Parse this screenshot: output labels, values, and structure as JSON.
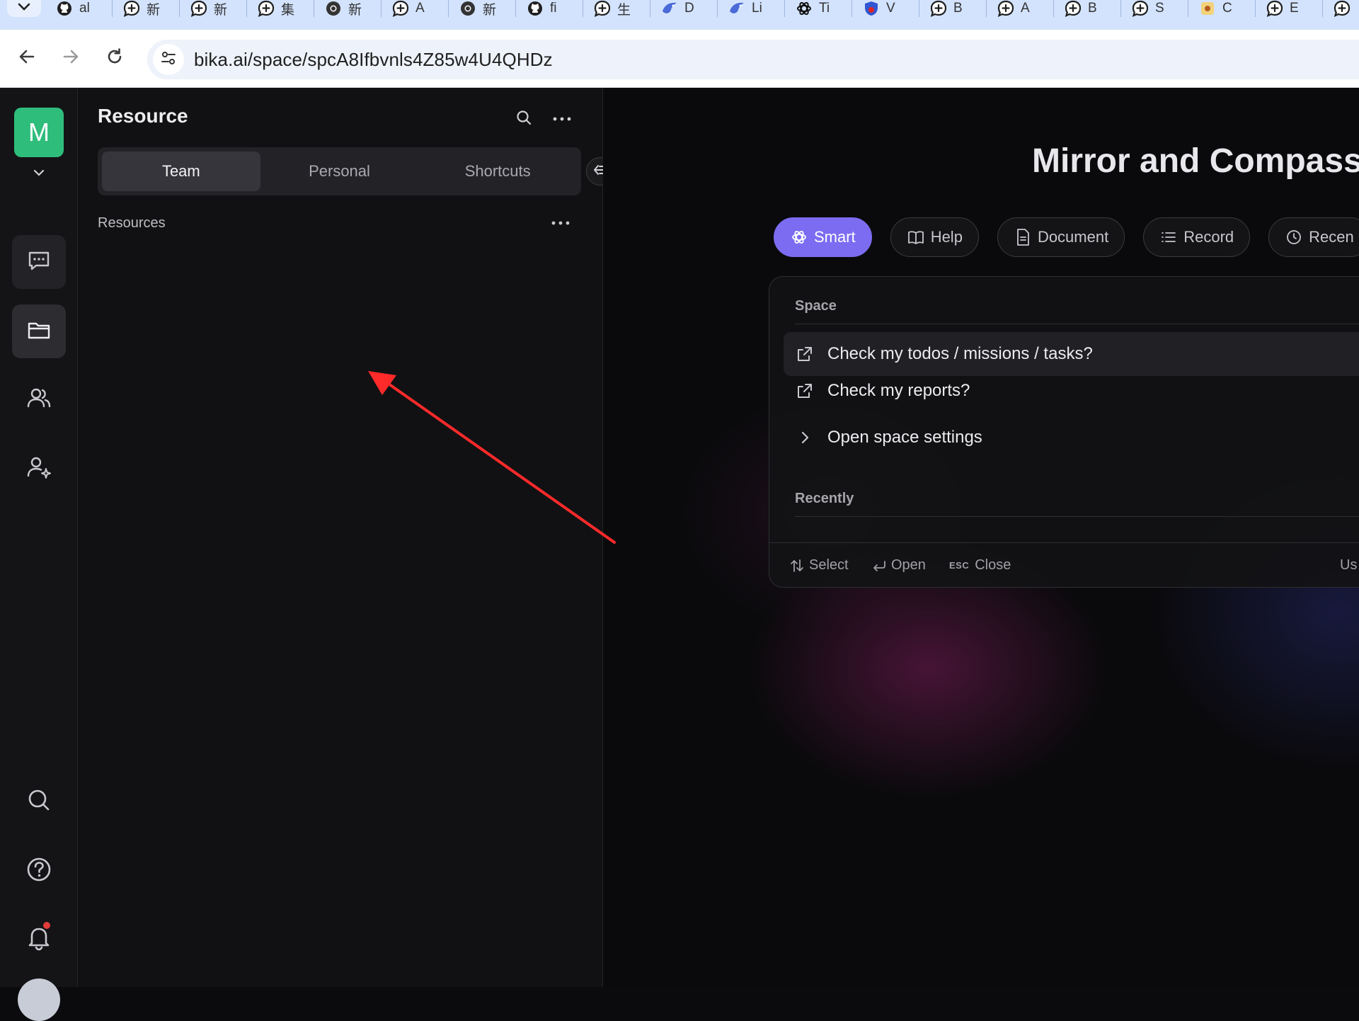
{
  "browser": {
    "tabs": [
      {
        "icon": "github-icon",
        "label": "al"
      },
      {
        "icon": "chat-plus-icon",
        "label": "新"
      },
      {
        "icon": "chat-plus-icon",
        "label": "新"
      },
      {
        "icon": "chat-plus-icon",
        "label": "集"
      },
      {
        "icon": "chrome-icon",
        "label": "新"
      },
      {
        "icon": "chat-plus-icon",
        "label": "A"
      },
      {
        "icon": "chrome-icon",
        "label": "新"
      },
      {
        "icon": "github-icon",
        "label": "fi"
      },
      {
        "icon": "chat-plus-icon",
        "label": "生"
      },
      {
        "icon": "bird-icon",
        "label": "D"
      },
      {
        "icon": "bird-icon",
        "label": "Li"
      },
      {
        "icon": "openai-icon",
        "label": "Ti"
      },
      {
        "icon": "shield-icon",
        "label": "V"
      },
      {
        "icon": "chat-plus-icon",
        "label": "B"
      },
      {
        "icon": "chat-plus-icon",
        "label": "A"
      },
      {
        "icon": "chat-plus-icon",
        "label": "B"
      },
      {
        "icon": "chat-plus-icon",
        "label": "S"
      },
      {
        "icon": "app-icon",
        "label": "C"
      },
      {
        "icon": "chat-plus-icon",
        "label": "E"
      },
      {
        "icon": "chat-plus-icon",
        "label": ""
      }
    ],
    "url": "bika.ai/space/spcA8Ifbvnls4Z85w4U4QHDz"
  },
  "rail": {
    "avatar_letter": "M"
  },
  "panel": {
    "title": "Resource",
    "tabs": [
      "Team",
      "Personal",
      "Shortcuts"
    ],
    "section_label": "Resources"
  },
  "main": {
    "title": "Mirror and Compass",
    "chips": [
      {
        "label": "Smart",
        "icon": "openai-icon",
        "active": true
      },
      {
        "label": "Help",
        "icon": "book-icon",
        "active": false
      },
      {
        "label": "Document",
        "icon": "document-icon",
        "active": false
      },
      {
        "label": "Record",
        "icon": "list-icon",
        "active": false
      },
      {
        "label": "Recen",
        "icon": "clock-icon",
        "active": false
      }
    ],
    "palette": {
      "space_label": "Space",
      "items": [
        {
          "label": "Check my todos / missions / tasks?",
          "icon": "external-link-icon"
        },
        {
          "label": "Check my reports?",
          "icon": "external-link-icon"
        },
        {
          "label": "Open space settings",
          "icon": "chevron-right-icon"
        }
      ],
      "recently_label": "Recently",
      "hints": {
        "select": "Select",
        "open": "Open",
        "esc": "ESC",
        "close": "Close",
        "right": "Us"
      }
    }
  },
  "colors": {
    "accent": "#7c6cf2",
    "avatar": "#2fbd7c",
    "annotation_arrow": "#ff2a2a"
  }
}
